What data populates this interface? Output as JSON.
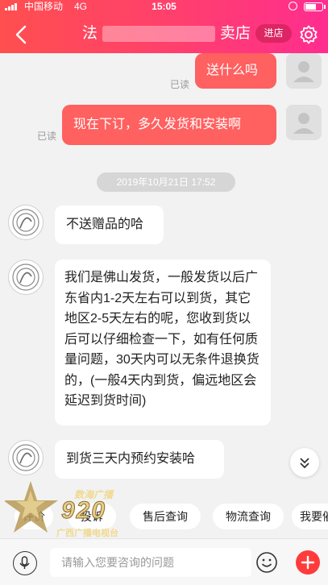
{
  "status_bar": {
    "carrier": "中国移动",
    "network": "4G",
    "time": "15:05"
  },
  "header": {
    "title_start": "法",
    "title_end": "卖店",
    "enter_shop_label": "进店",
    "back_icon": "chevron-left-icon",
    "settings_icon": "gear-icon",
    "gradient": [
      "#ff4f4f",
      "#ff2d8f"
    ]
  },
  "messages": [
    {
      "side": "out",
      "text": "送什么吗",
      "status": "已读"
    },
    {
      "side": "out",
      "text": "现在下订，多久发货和安装啊",
      "status": "已读"
    },
    {
      "side": "time",
      "text": "2019年10月21日 17:52"
    },
    {
      "side": "in",
      "text": "不送赠品的哈"
    },
    {
      "side": "in",
      "text": "我们是佛山发货，一般发货以后广东省内1-2天左右可以到货，其它地区2-5天左右的呢，您收到货以后可以仔细检查一下，如有任何质量问题，30天内可以无条件退换货的，(一般4天内到货，偏远地区会延迟到货时间)"
    },
    {
      "side": "in",
      "text": "到货三天内预约安装哈"
    }
  ],
  "quick_replies": [
    "评价",
    "投诉",
    "售后查询",
    "物流查询",
    "我要催"
  ],
  "input": {
    "placeholder": "请输入您要咨询的问题"
  },
  "watermark": {
    "top": "数海广播",
    "main": "920",
    "bottom": "广西广播电视台"
  },
  "colors": {
    "outgoing_bubble": "#ff6060",
    "incoming_bubble": "#ffffff",
    "background": "#f2f2f2",
    "accent": "#ff3b3b"
  }
}
